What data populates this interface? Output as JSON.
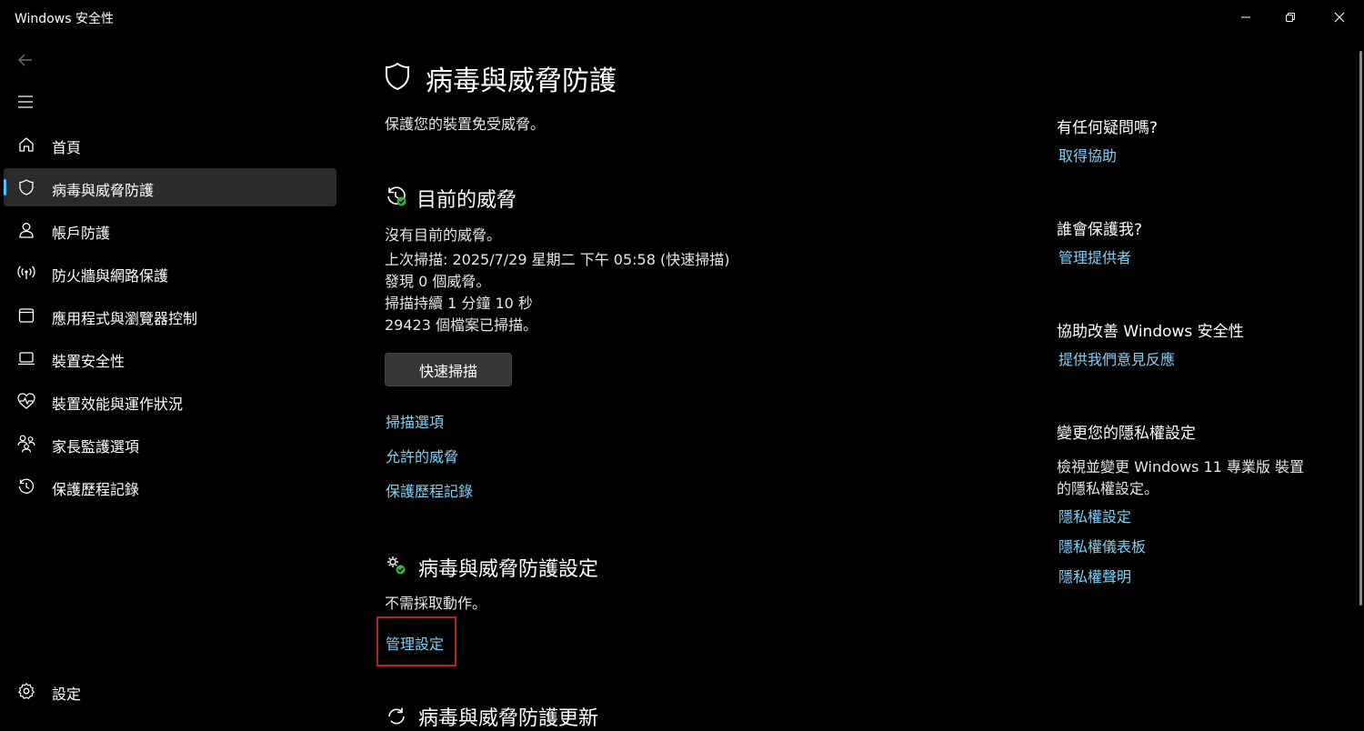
{
  "window": {
    "title": "Windows 安全性",
    "controls": [
      "minimize-icon",
      "restore-icon",
      "close-icon"
    ]
  },
  "sidebar": {
    "items": [
      {
        "label": "首頁",
        "icon": "home-icon",
        "selected": false
      },
      {
        "label": "病毒與威脅防護",
        "icon": "shield-icon",
        "selected": true
      },
      {
        "label": "帳戶防護",
        "icon": "person-icon",
        "selected": false
      },
      {
        "label": "防火牆與網路保護",
        "icon": "wifi-antenna-icon",
        "selected": false
      },
      {
        "label": "應用程式與瀏覽器控制",
        "icon": "app-window-icon",
        "selected": false
      },
      {
        "label": "裝置安全性",
        "icon": "laptop-icon",
        "selected": false
      },
      {
        "label": "裝置效能與運作狀況",
        "icon": "heart-pulse-icon",
        "selected": false
      },
      {
        "label": "家長監護選項",
        "icon": "family-icon",
        "selected": false
      },
      {
        "label": "保護歷程記錄",
        "icon": "history-icon",
        "selected": false
      }
    ],
    "settings_label": "設定"
  },
  "main": {
    "title": "病毒與威脅防護",
    "subtitle": "保護您的裝置免受威脅。",
    "current_threats": {
      "title": "目前的威脅",
      "lines": [
        "沒有目前的威脅。",
        "上次掃描: 2025/7/29 星期二 下午 05:58 (快速掃描)",
        "發現 0 個威脅。",
        "掃描持續 1 分鐘 10 秒",
        "29423 個檔案已掃描。"
      ],
      "scan_button": "快速掃描",
      "links": [
        "掃描選項",
        "允許的威脅",
        "保護歷程記錄"
      ]
    },
    "settings_section": {
      "title": "病毒與威脅防護設定",
      "status": "不需採取動作。",
      "manage_link": "管理設定"
    },
    "updates_section": {
      "title": "病毒與威脅防護更新"
    }
  },
  "right_panel": {
    "questions": {
      "heading": "有任何疑問嗎?",
      "link": "取得協助"
    },
    "protector": {
      "heading": "誰會保護我?",
      "link": "管理提供者"
    },
    "improve": {
      "heading": "協助改善 Windows 安全性",
      "link": "提供我們意見反應"
    },
    "privacy": {
      "heading": "變更您的隱私權設定",
      "desc_line1": "檢視並變更 Windows 11 專業版 裝置",
      "desc_line2": "的隱私權設定。",
      "links": [
        "隱私權設定",
        "隱私權儀表板",
        "隱私權聲明"
      ]
    }
  },
  "colors": {
    "background": "#000000",
    "link": "#7fd1f7",
    "accent": "#4cc2ff",
    "selected_bg": "#2b2b2b",
    "highlight": "#b3242f",
    "status_ok": "#3cb043"
  }
}
